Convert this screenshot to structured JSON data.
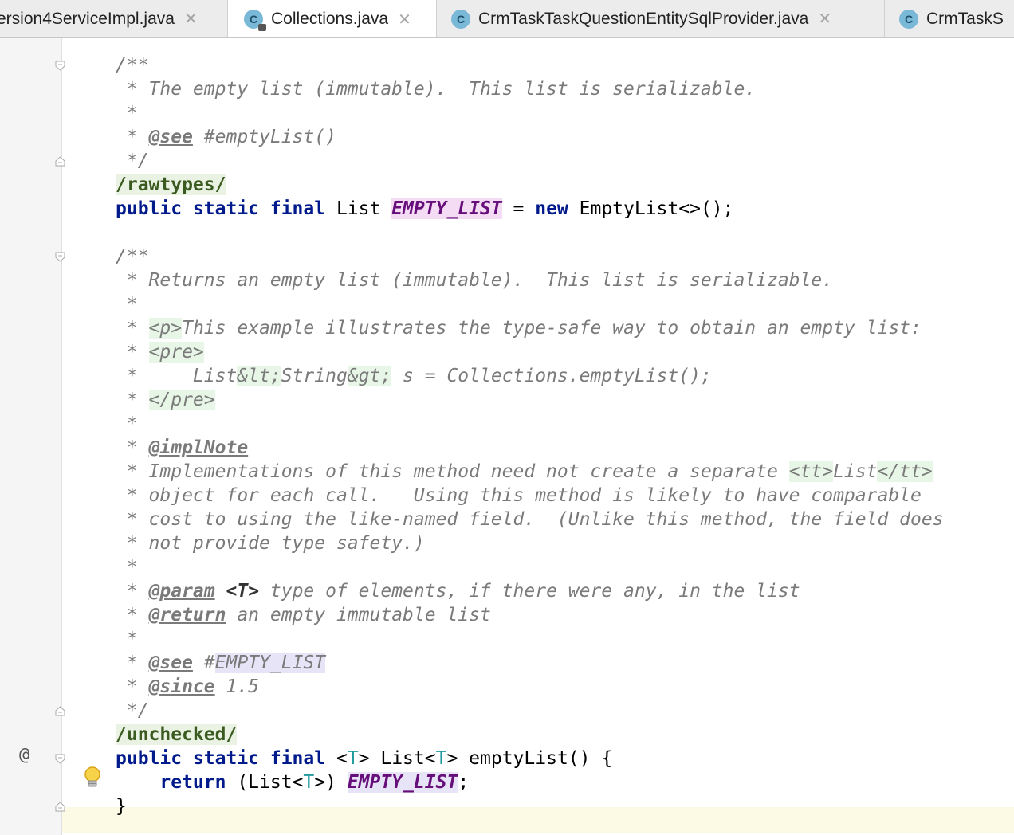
{
  "tabs": [
    {
      "label": "ersion4ServiceImpl.java",
      "active": false,
      "icon": "class-icon"
    },
    {
      "label": "Collections.java",
      "active": true,
      "icon": "class-locked-icon"
    },
    {
      "label": "CrmTaskTaskQuestionEntitySqlProvider.java",
      "active": false,
      "icon": "class-icon"
    },
    {
      "label": "CrmTaskS",
      "active": false,
      "icon": "class-icon"
    }
  ],
  "tab_icon_letter": "C",
  "close_glyph": "✕",
  "gutter": {
    "at_marker": "@"
  },
  "code": {
    "l1": "/**",
    "l2": " * The empty list (immutable).  This list is serializable.",
    "l3": " *",
    "l4_a": " * ",
    "l4_tag": "@see",
    "l4_b": " #emptyList()",
    "l5": " */",
    "l6_ann": "/rawtypes/",
    "l7_kw": "public static final",
    "l7_a": " List ",
    "l7_const": "EMPTY_LIST",
    "l7_b": " = ",
    "l7_new": "new",
    "l7_c": " EmptyList<>();",
    "l9": "/**",
    "l10": " * Returns an empty list (immutable).  This list is serializable.",
    "l11": " *",
    "l12_a": " * ",
    "l12_tag": "<p>",
    "l12_b": "This example illustrates the type-safe way to obtain an empty list:",
    "l13_a": " * ",
    "l13_tag": "<pre>",
    "l14_a": " *     List",
    "l14_lt": "&lt;",
    "l14_b": "String",
    "l14_gt": "&gt;",
    "l14_c": " s = Collections.emptyList();",
    "l15_a": " * ",
    "l15_tag": "</pre>",
    "l16": " *",
    "l17_a": " * ",
    "l17_tag": "@implNote",
    "l18_a": " * Implementations of this method need not create a separate ",
    "l18_tt1": "<tt>",
    "l18_b": "List",
    "l18_tt2": "</tt>",
    "l19": " * object for each call.   Using this method is likely to have comparable",
    "l20": " * cost to using the like-named field.  (Unlike this method, the field does",
    "l21": " * not provide type safety.)",
    "l22": " *",
    "l23_a": " * ",
    "l23_tag": "@param",
    "l23_b": " ",
    "l23_t": "<T>",
    "l23_c": " type of elements, if there were any, in the list",
    "l24_a": " * ",
    "l24_tag": "@return",
    "l24_b": " an empty immutable list",
    "l25": " *",
    "l26_a": " * ",
    "l26_tag": "@see",
    "l26_b": " #",
    "l26_ref": "EMPTY_LIST",
    "l27_a": " * ",
    "l27_tag": "@since",
    "l27_b": " 1.5",
    "l28": " */",
    "l29_ann": "/unchecked/",
    "l30_kw": "public static final",
    "l30_a": " <",
    "l30_t1": "T",
    "l30_b": "> List<",
    "l30_t2": "T",
    "l30_c": "> emptyList() {",
    "l31_indent": "    ",
    "l31_kw": "return",
    "l31_a": " (List<",
    "l31_t": "T",
    "l31_b": ">) ",
    "l31_const1": "EM",
    "l31_const2": "PTY_LIST",
    "l31_c": ";",
    "l32": "}"
  }
}
